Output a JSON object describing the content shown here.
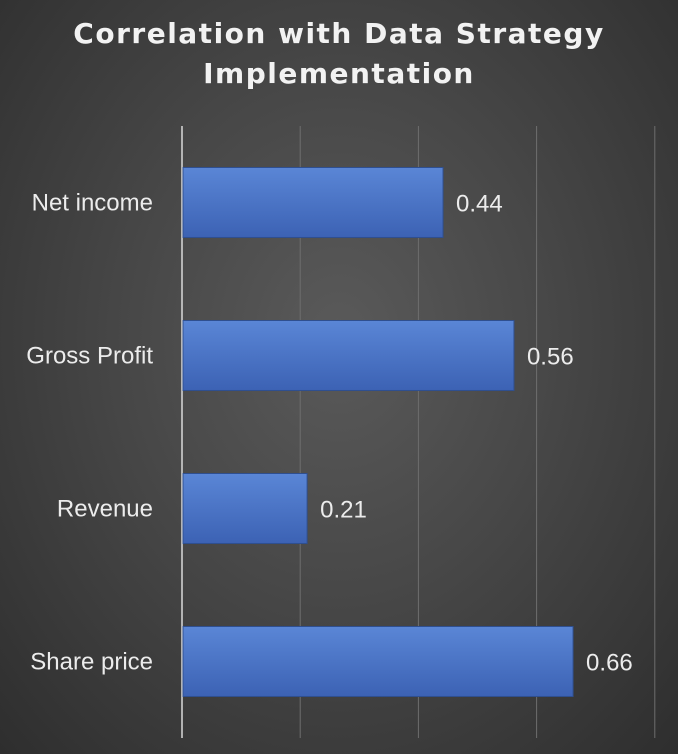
{
  "chart_data": {
    "type": "bar",
    "orientation": "horizontal",
    "title": "Correlation with Data Strategy\nImplementation",
    "categories": [
      "Net income",
      "Gross Profit",
      "Revenue",
      "Share price"
    ],
    "values": [
      0.44,
      0.56,
      0.21,
      0.66
    ],
    "value_labels": [
      "0.44",
      "0.56",
      "0.21",
      "0.66"
    ],
    "xlim": [
      0,
      0.8
    ],
    "grid": true,
    "bar_color": "#4472C4",
    "background_color": "#4a4a4a",
    "text_color": "#ececec"
  }
}
